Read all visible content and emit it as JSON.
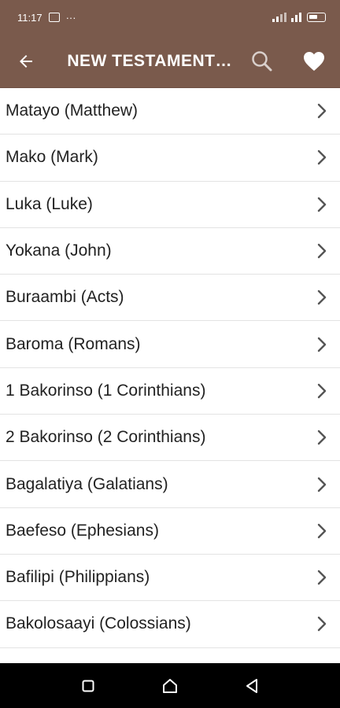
{
  "status_bar": {
    "time": "11:17",
    "dots": "···"
  },
  "header": {
    "title": "NEW TESTAMENT BOOKS",
    "background": "#7a5a4c"
  },
  "icons": {
    "back": "back-arrow-icon",
    "search": "search-icon",
    "favorite": "heart-icon",
    "chevron": "chevron-right-icon"
  },
  "books": [
    {
      "label": "Matayo (Matthew)"
    },
    {
      "label": "Mako (Mark)"
    },
    {
      "label": "Luka (Luke)"
    },
    {
      "label": "Yokana (John)"
    },
    {
      "label": "Buraambi (Acts)"
    },
    {
      "label": "Baroma (Romans)"
    },
    {
      "label": "1 Bakorinso (1 Corinthians)"
    },
    {
      "label": "2 Bakorinso (2 Corinthians)"
    },
    {
      "label": "Bagalatiya (Galatians)"
    },
    {
      "label": "Baefeso (Ephesians)"
    },
    {
      "label": "Bafilipi (Philippians)"
    },
    {
      "label": "Bakolosaayi (Colossians)"
    },
    {
      "label": ""
    }
  ]
}
